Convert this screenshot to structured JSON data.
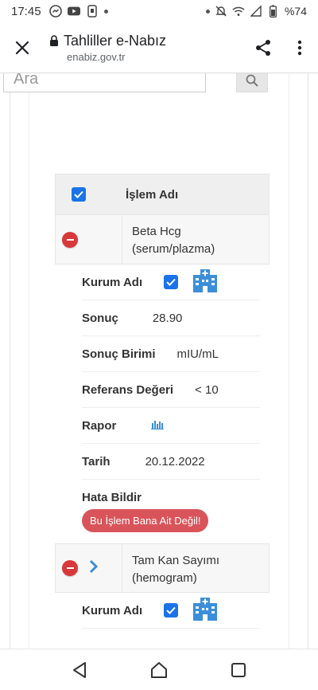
{
  "status_bar": {
    "time": "17:45",
    "battery": "%74",
    "icons": [
      "messenger-icon",
      "youtube-icon",
      "phone-icon",
      "mute-icon",
      "wifi-icon",
      "signal-icon",
      "battery-icon"
    ]
  },
  "browser": {
    "title": "Tahliller e-Nabız",
    "url": "enabiz.gov.tr"
  },
  "search": {
    "placeholder": "Ara"
  },
  "table": {
    "header_label": "İşlem Adı",
    "tests": [
      {
        "name_line1": "Beta Hcg",
        "name_line2": "(serum/plazma)",
        "details": {
          "kurum_label": "Kurum Adı",
          "sonuc_label": "Sonuç",
          "sonuc_value": "28.90",
          "birim_label": "Sonuç Birimi",
          "birim_value": "mIU/mL",
          "referans_label": "Referans Değeri",
          "referans_value": "< 10",
          "rapor_label": "Rapor",
          "tarih_label": "Tarih",
          "tarih_value": "20.12.2022",
          "hata_label": "Hata Bildir",
          "hata_button": "Bu İşlem Bana Ait Değil!"
        }
      },
      {
        "name_line1": "Tam Kan Sayımı",
        "name_line2": "(hemogram)",
        "details": {
          "kurum_label": "Kurum Adı"
        }
      }
    ]
  },
  "colors": {
    "accent_blue": "#1a73e8",
    "minus_red": "#d9383a",
    "hata_button": "#d9545a",
    "hospital_icon": "#3b8fd9"
  }
}
